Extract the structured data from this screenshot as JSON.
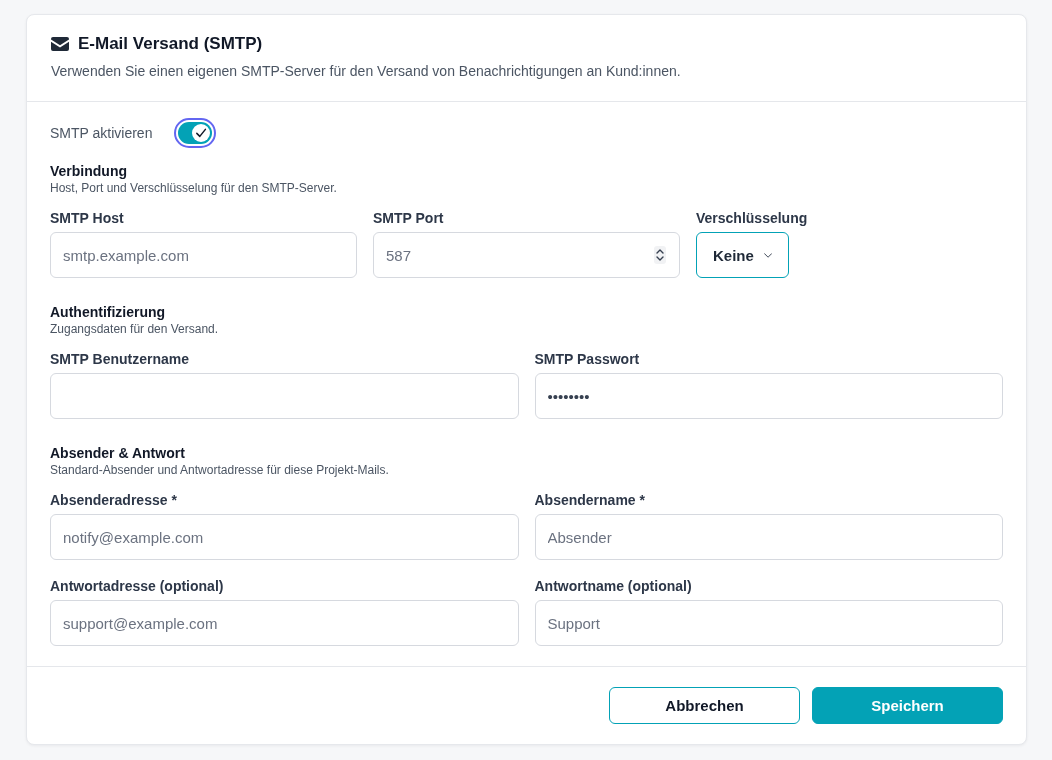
{
  "header": {
    "title": "E-Mail Versand (SMTP)",
    "description": "Verwenden Sie einen eigenen SMTP-Server für den Versand von Benachrichtigungen an Kund:innen."
  },
  "smtp_toggle": {
    "label": "SMTP aktivieren",
    "on": true,
    "focused": true
  },
  "sections": [
    {
      "title": "Verbindung",
      "description": "Host, Port und Verschlüsselung für den SMTP-Server.",
      "rows": [
        [
          {
            "kind": "text",
            "label": "SMTP Host",
            "placeholder": "smtp.example.com"
          },
          {
            "kind": "number",
            "label": "SMTP Port",
            "placeholder": "587"
          },
          {
            "kind": "select",
            "label": "Verschlüsselung",
            "value": "Keine"
          }
        ]
      ]
    },
    {
      "title": "Authentifizierung",
      "description": "Zugangsdaten für den Versand.",
      "rows": [
        [
          {
            "kind": "text",
            "label": "SMTP Benutzername"
          },
          {
            "kind": "text",
            "label": "SMTP Passwort",
            "value": "••••••••"
          }
        ]
      ]
    },
    {
      "title": "Absender & Antwort",
      "description": "Standard-Absender und Antwortadresse für diese Projekt-Mails.",
      "rows": [
        [
          {
            "kind": "text",
            "label": "Absenderadresse *",
            "placeholder": "notify@example.com"
          },
          {
            "kind": "text",
            "label": "Absendername *",
            "placeholder": "Absender"
          }
        ],
        [
          {
            "kind": "text",
            "label": "Antwortadresse (optional)",
            "placeholder": "support@example.com"
          },
          {
            "kind": "text",
            "label": "Antwortname (optional)",
            "placeholder": "Support"
          }
        ]
      ]
    }
  ],
  "buttons": [
    {
      "kind": "secondary",
      "label": "Abbrechen"
    },
    {
      "kind": "primary",
      "label": "Speichern"
    }
  ]
}
